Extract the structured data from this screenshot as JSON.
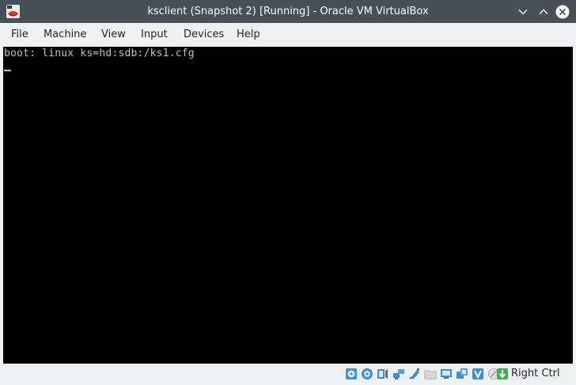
{
  "window": {
    "title": "ksclient (Snapshot 2) [Running] - Oracle VM VirtualBox"
  },
  "menu": {
    "items": [
      {
        "label": "File"
      },
      {
        "label": "Machine"
      },
      {
        "label": "View"
      },
      {
        "label": "Input"
      },
      {
        "label": "Devices"
      },
      {
        "label": "Help"
      }
    ]
  },
  "console": {
    "line1": "boot: linux ks=hd:sdb:/ks1.cfg"
  },
  "statusbar": {
    "icons": [
      "hard-disk-icon",
      "optical-drive-icon",
      "audio-icon",
      "network-icon",
      "usb-icon",
      "shared-folders-icon",
      "display-icon",
      "video-capture-icon",
      "virtualization-icon",
      "mouse-integration-icon",
      "host-key-arrow-icon"
    ],
    "host_key": "Right Ctrl"
  },
  "colors": {
    "titlebar": "#475057",
    "menubar": "#eff0f1",
    "screen": "#000000",
    "console_text": "#c0c0c0",
    "accent": "#3daee9"
  }
}
